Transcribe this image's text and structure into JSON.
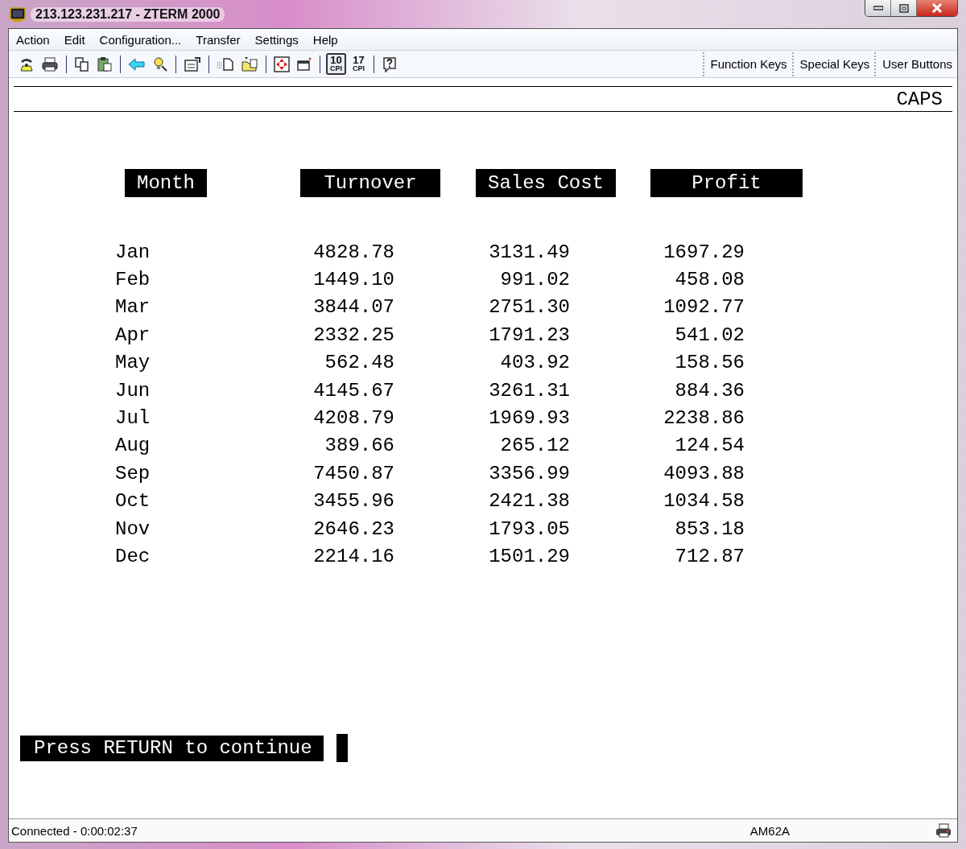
{
  "window": {
    "title": "213.123.231.217 - ZTERM 2000"
  },
  "menu": [
    "Action",
    "Edit",
    "Configuration...",
    "Transfer",
    "Settings",
    "Help"
  ],
  "toolbar": {
    "cpi_buttons": [
      {
        "number": "10",
        "unit": "CPI",
        "selected": true
      },
      {
        "number": "17",
        "unit": "CPI",
        "selected": false
      }
    ],
    "panels": [
      "Function Keys",
      "Special Keys",
      "User Buttons"
    ]
  },
  "terminal": {
    "mode": "CAPS",
    "columns": [
      "Month",
      "Turnover",
      "Sales Cost",
      "Profit"
    ],
    "rows": [
      [
        "Jan",
        "4828.78",
        "3131.49",
        "1697.29"
      ],
      [
        "Feb",
        "1449.10",
        "991.02",
        "458.08"
      ],
      [
        "Mar",
        "3844.07",
        "2751.30",
        "1092.77"
      ],
      [
        "Apr",
        "2332.25",
        "1791.23",
        "541.02"
      ],
      [
        "May",
        "562.48",
        "403.92",
        "158.56"
      ],
      [
        "Jun",
        "4145.67",
        "3261.31",
        "884.36"
      ],
      [
        "Jul",
        "4208.79",
        "1969.93",
        "2238.86"
      ],
      [
        "Aug",
        "389.66",
        "265.12",
        "124.54"
      ],
      [
        "Sep",
        "7450.87",
        "3356.99",
        "4093.88"
      ],
      [
        "Oct",
        "3455.96",
        "2421.38",
        "1034.58"
      ],
      [
        "Nov",
        "2646.23",
        "1793.05",
        "853.18"
      ],
      [
        "Dec",
        "2214.16",
        "1501.29",
        "712.87"
      ]
    ],
    "prompt": "Press RETURN to continue"
  },
  "status_bar": {
    "connection": "Connected - 0:00:02:37",
    "terminal_type": "AM62A"
  }
}
